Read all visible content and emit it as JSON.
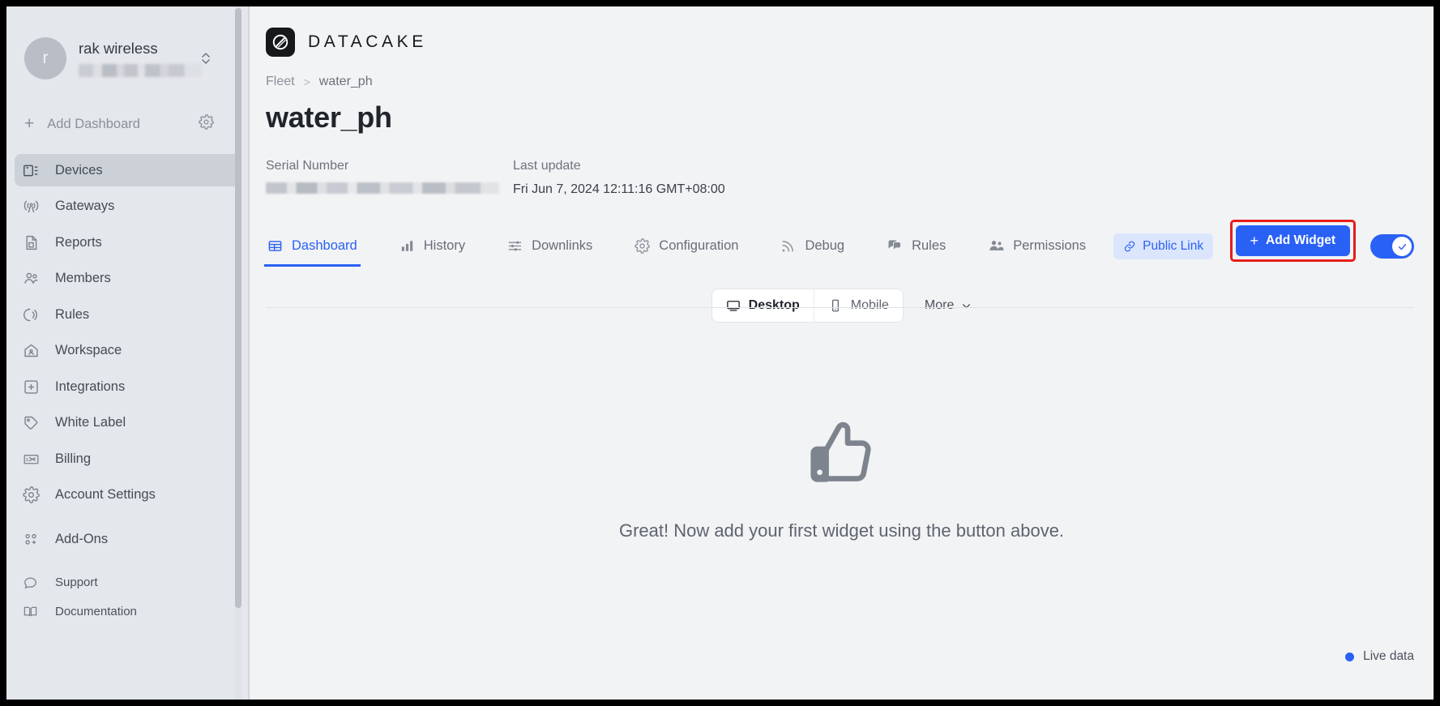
{
  "sidebar": {
    "workspace": {
      "initial": "r",
      "name": "rak wireless",
      "subtitle_redacted": true
    },
    "add_dashboard": {
      "label": "Add Dashboard",
      "plus": "+",
      "settings_icon": "gear-icon"
    },
    "items": [
      {
        "label": "Devices",
        "icon": "devices-icon",
        "active": true
      },
      {
        "label": "Gateways",
        "icon": "antenna-icon",
        "active": false
      },
      {
        "label": "Reports",
        "icon": "document-icon",
        "active": false
      },
      {
        "label": "Members",
        "icon": "people-icon",
        "active": false
      },
      {
        "label": "Rules",
        "icon": "broadcast-icon",
        "active": false
      },
      {
        "label": "Workspace",
        "icon": "home-icon",
        "active": false
      },
      {
        "label": "Integrations",
        "icon": "plus-square-icon",
        "active": false
      },
      {
        "label": "White Label",
        "icon": "tag-icon",
        "active": false
      },
      {
        "label": "Billing",
        "icon": "invoice-icon",
        "active": false
      },
      {
        "label": "Account Settings",
        "icon": "gear-icon",
        "active": false
      },
      {
        "label": "Add-Ons",
        "icon": "apps-plus-icon",
        "active": false
      }
    ],
    "bottom_items": [
      {
        "label": "Support",
        "icon": "chat-bubble-icon"
      },
      {
        "label": "Documentation",
        "icon": "book-icon"
      }
    ]
  },
  "header": {
    "logo_text": "DATACAKE",
    "logo_icon": "datacake-logo-icon"
  },
  "breadcrumb": {
    "root": "Fleet",
    "separator": ">",
    "current": "water_ph"
  },
  "page": {
    "title": "water_ph",
    "serial_number_label": "Serial Number",
    "serial_number_value": "",
    "last_update_label": "Last update",
    "last_update_value": "Fri Jun 7, 2024 12:11:16 GMT+08:00"
  },
  "tabs": [
    {
      "label": "Dashboard",
      "icon": "table-icon",
      "active": true
    },
    {
      "label": "History",
      "icon": "bar-chart-icon",
      "active": false
    },
    {
      "label": "Downlinks",
      "icon": "sliders-icon",
      "active": false
    },
    {
      "label": "Configuration",
      "icon": "gear-icon",
      "active": false
    },
    {
      "label": "Debug",
      "icon": "signal-icon",
      "active": false
    },
    {
      "label": "Rules",
      "icon": "speech-bubbles-icon",
      "active": false
    },
    {
      "label": "Permissions",
      "icon": "people-icon",
      "active": false
    }
  ],
  "actions": {
    "public_link": {
      "label": "Public Link",
      "icon": "link-icon"
    },
    "add_widget": {
      "label": "Add Widget",
      "plus": "+",
      "highlighted": true
    },
    "edit_toggle": {
      "state": "on",
      "icon": "check-icon"
    }
  },
  "view_switch": {
    "options": [
      {
        "label": "Desktop",
        "icon": "monitor-icon",
        "active": true
      },
      {
        "label": "Mobile",
        "icon": "phone-icon",
        "active": false
      }
    ],
    "more": {
      "label": "More",
      "icon": "chevron-down-icon"
    }
  },
  "empty_state": {
    "icon": "thumbs-up-icon",
    "message": "Great! Now add your first widget using the button above."
  },
  "status": {
    "live_label": "Live data",
    "indicator_color": "#2a61f5"
  },
  "colors": {
    "accent": "#2a61f5",
    "highlight_box": "#e81c1c",
    "sidebar_bg": "#e4e7eb",
    "main_bg": "#f2f3f5"
  }
}
